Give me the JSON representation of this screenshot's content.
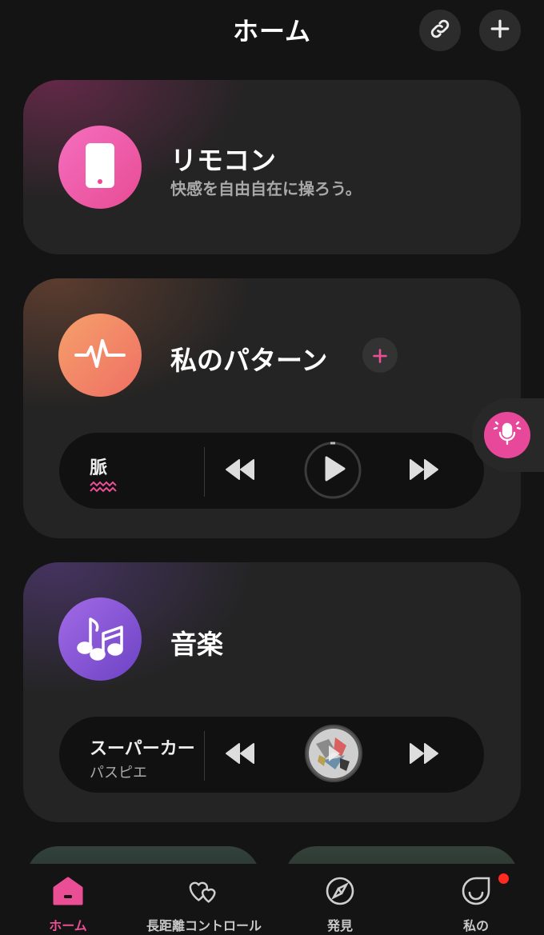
{
  "header": {
    "title": "ホーム",
    "link_icon": "link-icon",
    "add_icon": "plus-icon"
  },
  "cards": {
    "remote": {
      "title": "リモコン",
      "subtitle": "快感を自由自在に操ろう。",
      "icon": "phone-icon"
    },
    "patterns": {
      "title": "私のパターン",
      "icon": "heartbeat-icon",
      "add_icon": "plus-icon",
      "player": {
        "track": "脈",
        "wave_icon": "wave-icon"
      }
    },
    "music": {
      "title": "音楽",
      "icon": "music-notes-icon",
      "player": {
        "track": "スーパーカー",
        "artist": "パスピエ"
      }
    }
  },
  "voice": {
    "icon": "microphone-icon"
  },
  "nav": {
    "items": [
      {
        "label": "ホーム",
        "icon": "home-icon",
        "active": true
      },
      {
        "label": "長距離コントロール",
        "icon": "hearts-icon",
        "active": false
      },
      {
        "label": "発見",
        "icon": "compass-icon",
        "active": false
      },
      {
        "label": "私の",
        "icon": "smile-icon",
        "active": false,
        "badge": true
      }
    ]
  },
  "colors": {
    "accent": "#ea4f96",
    "background": "#141414",
    "card": "#242424",
    "badge": "#ff2a22"
  }
}
